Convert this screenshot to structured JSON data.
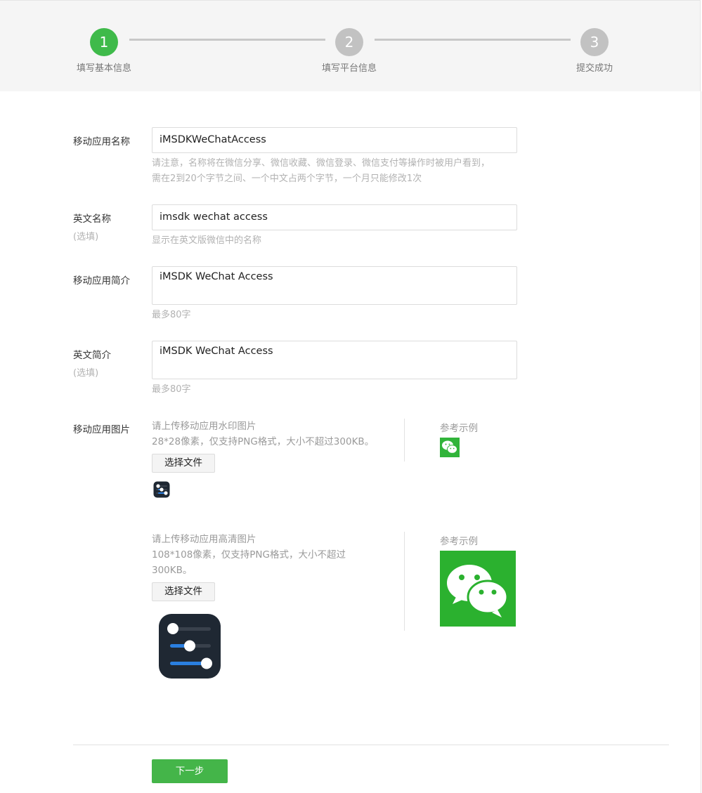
{
  "steps": [
    {
      "number": "1",
      "label": "填写基本信息",
      "active": true
    },
    {
      "number": "2",
      "label": "填写平台信息",
      "active": false
    },
    {
      "number": "3",
      "label": "提交成功",
      "active": false
    }
  ],
  "form": {
    "app_name": {
      "label": "移动应用名称",
      "value": "iMSDKWeChatAccess",
      "hint_line1": "请注意，名称将在微信分享、微信收藏、微信登录、微信支付等操作时被用户看到，",
      "hint_line2": "需在2到20个字节之间、一个中文占两个字节，一个月只能修改1次"
    },
    "en_name": {
      "label": "英文名称",
      "optional": "(选填)",
      "value": "imsdk wechat access",
      "hint": "显示在英文版微信中的名称"
    },
    "app_intro": {
      "label": "移动应用简介",
      "value": "iMSDK WeChat Access",
      "hint": "最多80字"
    },
    "en_intro": {
      "label": "英文简介",
      "optional": "(选填)",
      "value": "iMSDK WeChat Access",
      "hint": "最多80字"
    },
    "app_image": {
      "label": "移动应用图片",
      "watermark": {
        "hint_line1": "请上传移动应用水印图片",
        "hint_line2": "28*28像素，仅支持PNG格式，大小不超过300KB。",
        "button": "选择文件",
        "ref_label": "参考示例"
      },
      "hd": {
        "hint_line1": "请上传移动应用高清图片",
        "hint_line2": "108*108像素，仅支持PNG格式，大小不超过",
        "hint_line3": "300KB。",
        "button": "选择文件",
        "ref_label": "参考示例"
      }
    }
  },
  "footer": {
    "next_label": "下一步"
  },
  "colors": {
    "accent": "#44b549",
    "step_active": "#3fba4a",
    "step_inactive": "#c2c2c2",
    "wechat_green": "#2bb12f"
  }
}
